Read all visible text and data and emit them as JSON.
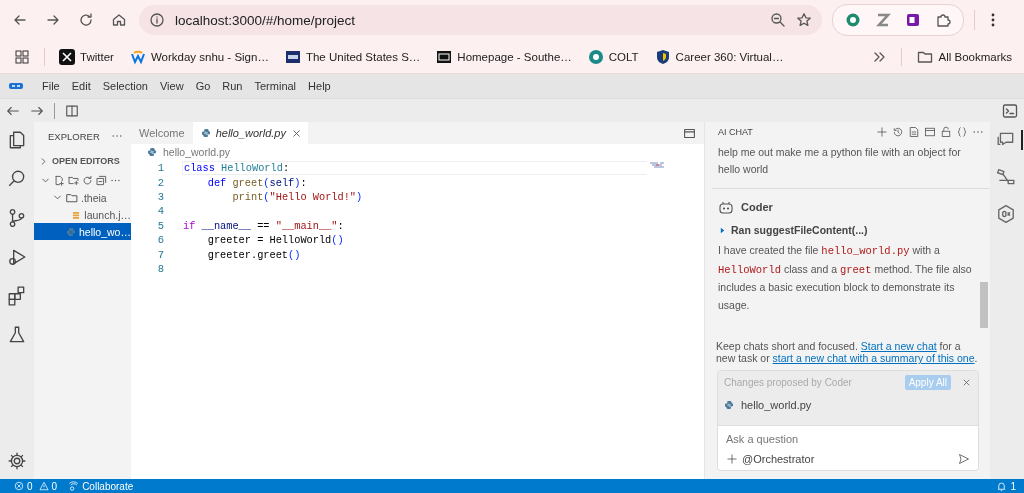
{
  "browser": {
    "url": "localhost:3000/#/home/project"
  },
  "bookmarks": [
    {
      "label": "Twitter",
      "kind": "x"
    },
    {
      "label": "Workday snhu - Sign…",
      "kind": "workday"
    },
    {
      "label": "The United States S…",
      "kind": "seal"
    },
    {
      "label": "Homepage - Southe…",
      "kind": "dark"
    },
    {
      "label": "COLT",
      "kind": "colt"
    },
    {
      "label": "Career 360: Virtual…",
      "kind": "shield"
    }
  ],
  "all_bookmarks": "All Bookmarks",
  "menu": [
    "File",
    "Edit",
    "Selection",
    "View",
    "Go",
    "Run",
    "Terminal",
    "Help"
  ],
  "explorer": {
    "title": "EXPLORER",
    "open_editors": {
      "label": "OPEN EDITORS",
      "expanded": false
    },
    "workspace": {
      "expanded": true,
      "tree": [
        {
          "label": ".theia",
          "kind": "folder",
          "expanded": true,
          "selected": false,
          "children": [
            {
              "label": "launch.j…",
              "kind": "json",
              "selected": false
            }
          ]
        },
        {
          "label": "hello_wo…",
          "kind": "python",
          "selected": true
        }
      ]
    }
  },
  "editor": {
    "tabs": [
      {
        "label": "Welcome",
        "kind": "plain",
        "selected": false
      },
      {
        "label": "hello_world.py",
        "kind": "python",
        "selected": true
      }
    ],
    "breadcrumb": "hello_world.py",
    "lines": [
      {
        "number": "1",
        "tokens": [
          {
            "text": "class",
            "kind": "kw"
          },
          {
            "text": " HelloWorld",
            "kind": "cls"
          },
          {
            "text": ":",
            "kind": "plain"
          }
        ]
      },
      {
        "number": "2",
        "tokens": [
          {
            "text": "    def",
            "kind": "kw"
          },
          {
            "text": " greet",
            "kind": "fn"
          },
          {
            "text": "(",
            "kind": "paren"
          },
          {
            "text": "self",
            "kind": "var"
          },
          {
            "text": ")",
            "kind": "paren"
          },
          {
            "text": ":",
            "kind": "plain"
          }
        ]
      },
      {
        "number": "3",
        "tokens": [
          {
            "text": "        print",
            "kind": "fn"
          },
          {
            "text": "(",
            "kind": "paren"
          },
          {
            "text": "\"Hello World!\"",
            "kind": "str"
          },
          {
            "text": ")",
            "kind": "paren"
          }
        ]
      },
      {
        "number": "4"
      },
      {
        "number": "5",
        "tokens": [
          {
            "text": "if",
            "kind": "ctl"
          },
          {
            "text": " __name__",
            "kind": "var"
          },
          {
            "text": " == ",
            "kind": "plain"
          },
          {
            "text": "\"__main__\"",
            "kind": "str"
          },
          {
            "text": ":",
            "kind": "plain"
          }
        ]
      },
      {
        "number": "6",
        "tokens": [
          {
            "text": "    greeter = HelloWorld",
            "kind": "plain"
          },
          {
            "text": "()",
            "kind": "paren"
          }
        ]
      },
      {
        "number": "7",
        "tokens": [
          {
            "text": "    greeter.greet",
            "kind": "plain"
          },
          {
            "text": "()",
            "kind": "paren"
          }
        ]
      },
      {
        "number": "8"
      }
    ]
  },
  "chat": {
    "title": "AI CHAT",
    "user_message": "help me out make me a python file with an object for hello world",
    "agent": "Coder",
    "tool_call": {
      "label": "Ran suggestFileContent(...)",
      "expanded": false
    },
    "response": [
      {
        "text": "I have created the file ",
        "kind": "text"
      },
      {
        "text": "hello_world.py",
        "kind": "code"
      },
      {
        "text": " with a ",
        "kind": "text"
      },
      {
        "text": "HelloWorld",
        "kind": "code"
      },
      {
        "text": " class and a ",
        "kind": "text"
      },
      {
        "text": "greet",
        "kind": "code"
      },
      {
        "text": " method. The file also includes a basic execution block to demonstrate its usage.",
        "kind": "text"
      }
    ],
    "hint": [
      {
        "text": "Keep chats short and focused. ",
        "kind": "text"
      },
      {
        "text": "Start a new chat",
        "kind": "link"
      },
      {
        "text": " for a new task or ",
        "kind": "text"
      },
      {
        "text": "start a new chat with a summary of this one",
        "kind": "link"
      },
      {
        "text": ".",
        "kind": "text"
      }
    ],
    "changes": {
      "title": "Changes proposed by Coder",
      "apply": {
        "label": "Apply All",
        "disabled": true
      },
      "files": [
        "hello_world.py"
      ]
    },
    "input": {
      "placeholder": "Ask a question",
      "agent": "@Orchestrator"
    }
  },
  "status_bar": {
    "errors": "0",
    "warnings": "0",
    "collaborate": "Collaborate",
    "notifications": "1"
  }
}
